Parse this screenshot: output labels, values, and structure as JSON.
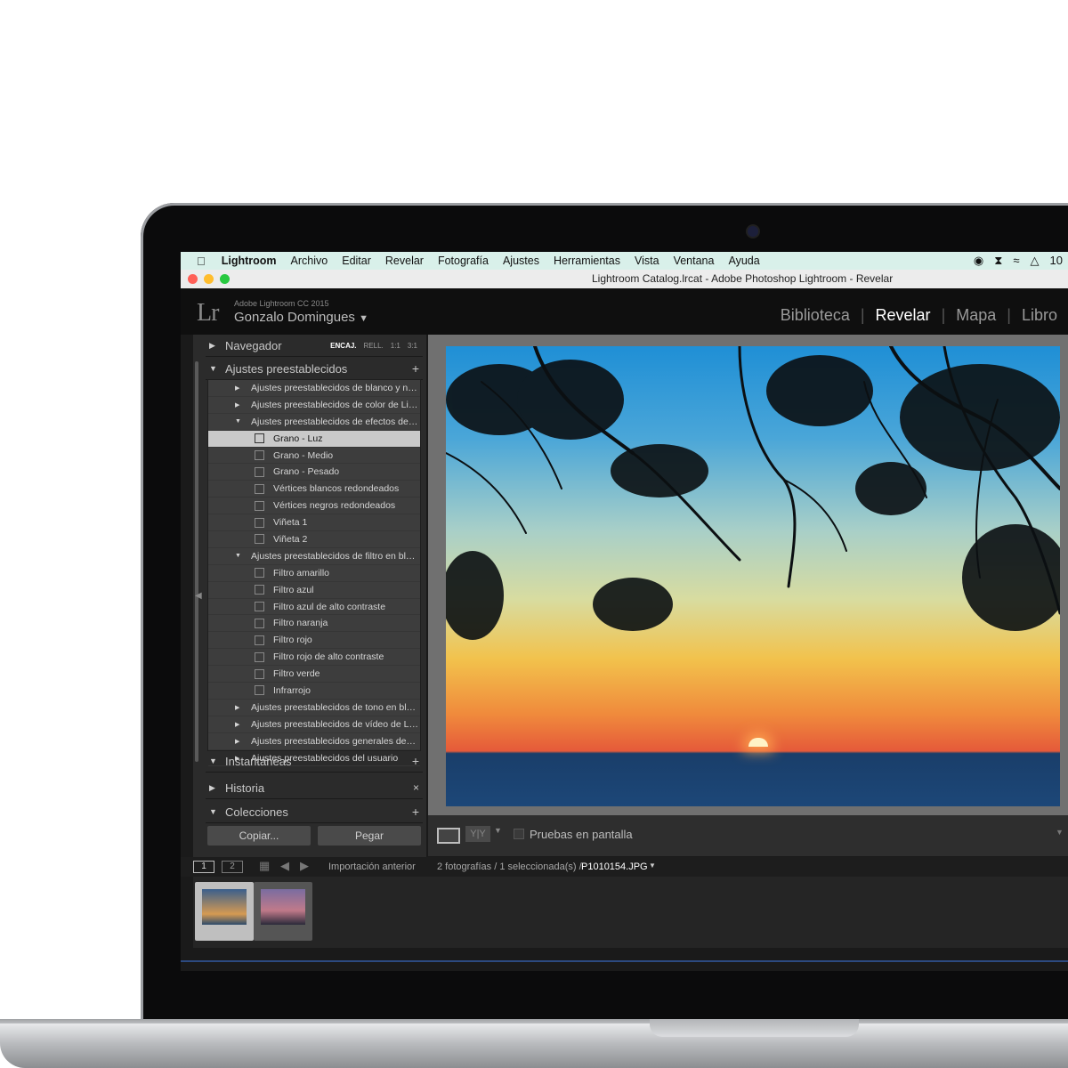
{
  "menubar": {
    "app": "Lightroom",
    "items": [
      "Archivo",
      "Editar",
      "Revelar",
      "Fotografía",
      "Ajustes",
      "Herramientas",
      "Vista",
      "Ventana",
      "Ayuda"
    ],
    "status_right": "10"
  },
  "window": {
    "title": "Lightroom Catalog.lrcat - Adobe Photoshop Lightroom - Revelar"
  },
  "identity": {
    "logo": "Lr",
    "product": "Adobe Lightroom CC 2015",
    "user": "Gonzalo Domingues",
    "dropdown": "▼"
  },
  "modules": [
    "Biblioteca",
    "Revelar",
    "Mapa",
    "Libro"
  ],
  "active_module": "Revelar",
  "left_panel": {
    "navigator": {
      "label": "Navegador",
      "zoom": [
        "ENCAJ.",
        "RELL.",
        "1:1",
        "3:1"
      ]
    },
    "presets": {
      "label": "Ajustes preestablecidos",
      "rows": [
        {
          "type": "folder",
          "open": false,
          "label": "Ajustes preestablecidos de blanco y n…"
        },
        {
          "type": "folder",
          "open": false,
          "label": "Ajustes preestablecidos de color de Li…"
        },
        {
          "type": "folder",
          "open": true,
          "label": "Ajustes preestablecidos de efectos de…"
        },
        {
          "type": "item",
          "label": "Grano - Luz",
          "selected": true
        },
        {
          "type": "item",
          "label": "Grano - Medio"
        },
        {
          "type": "item",
          "label": "Grano - Pesado"
        },
        {
          "type": "item",
          "label": "Vértices blancos redondeados"
        },
        {
          "type": "item",
          "label": "Vértices negros redondeados"
        },
        {
          "type": "item",
          "label": "Viñeta 1"
        },
        {
          "type": "item",
          "label": "Viñeta 2"
        },
        {
          "type": "folder",
          "open": true,
          "label": "Ajustes preestablecidos de filtro en bl…"
        },
        {
          "type": "item",
          "label": "Filtro amarillo"
        },
        {
          "type": "item",
          "label": "Filtro azul"
        },
        {
          "type": "item",
          "label": "Filtro azul de alto contraste"
        },
        {
          "type": "item",
          "label": "Filtro naranja"
        },
        {
          "type": "item",
          "label": "Filtro rojo"
        },
        {
          "type": "item",
          "label": "Filtro rojo de alto contraste"
        },
        {
          "type": "item",
          "label": "Filtro verde"
        },
        {
          "type": "item",
          "label": "Infrarrojo"
        },
        {
          "type": "folder",
          "open": false,
          "label": "Ajustes preestablecidos de tono en bl…"
        },
        {
          "type": "folder",
          "open": false,
          "label": "Ajustes preestablecidos de vídeo de L…"
        },
        {
          "type": "folder",
          "open": false,
          "label": "Ajustes preestablecidos generales de…"
        },
        {
          "type": "folder",
          "open": false,
          "label": "Ajustes preestablecidos del usuario"
        }
      ]
    },
    "snapshots": {
      "label": "Instantáneas"
    },
    "history": {
      "label": "Historia"
    },
    "collections": {
      "label": "Colecciones"
    },
    "copy_button": "Copiar...",
    "paste_button": "Pegar"
  },
  "toolbar": {
    "proof_label": "Pruebas en pantalla",
    "yy": "Y|Y"
  },
  "filmstrip": {
    "view1": "1",
    "view2": "2",
    "source": "Importación anterior",
    "count": "2 fotografías / 1 seleccionada(s) /",
    "filename": "P1010154.JPG",
    "selected_index": 0
  },
  "colors": {
    "menubar_bg": "#d9f0ea",
    "panel_bg": "#2b2b2b",
    "selected_row": "#c9c9c9",
    "active_module": "#ffffff"
  }
}
